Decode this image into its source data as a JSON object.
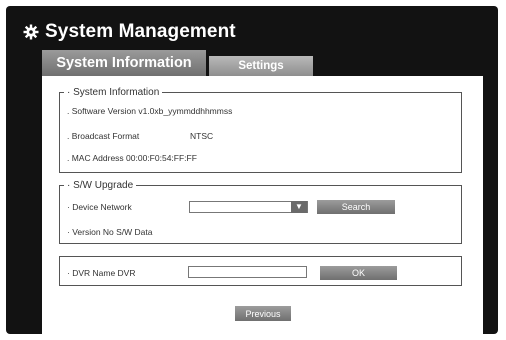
{
  "window": {
    "title": "System Management",
    "icon": "gear-icon"
  },
  "tabs": [
    {
      "label": "System Information",
      "active": true
    },
    {
      "label": "Settings",
      "active": false
    }
  ],
  "system_info": {
    "legend": "System Information",
    "software_version": ". Software Version  v1.0xb_yymmddhhmmss",
    "broadcast_format_label": ". Broadcast Format",
    "broadcast_format_value": "NTSC",
    "mac_address": ". MAC Address 00:00:F0:54:FF:FF"
  },
  "sw_upgrade": {
    "legend": "S/W Upgrade",
    "device_label": "· Device  Network",
    "device_value": "",
    "search_label": "Search",
    "version_label": "· Version  No S/W Data"
  },
  "dvr": {
    "name_label": "· DVR Name  DVR",
    "name_value": "",
    "ok_label": "OK"
  },
  "footer": {
    "previous_label": "Previous"
  },
  "colors": {
    "frame": "#121212",
    "tab_active": "#8a8a8a",
    "button": "#858585"
  }
}
